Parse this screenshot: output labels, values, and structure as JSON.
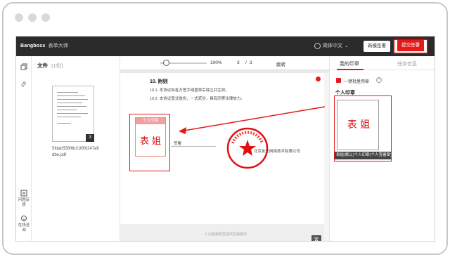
{
  "window": {
    "controls": [
      "dot",
      "dot",
      "dot"
    ]
  },
  "topbar": {
    "logo": "Bangboss",
    "logo_sub": "表单大师",
    "language": "简体中文",
    "switch_button": "新模签署",
    "submit_button": "提交签署"
  },
  "leftrail": {
    "items": [
      {
        "icon": "copy-icon"
      },
      {
        "icon": "paperclip-icon"
      },
      {
        "icon": "feedback-icon",
        "label": "问题反馈"
      },
      {
        "icon": "support-icon",
        "label": "在线咨询"
      }
    ]
  },
  "filepanel": {
    "title": "文件",
    "count": "(1份)",
    "thumbnail_page": "3",
    "filename": "5fdab556f6b31f8f0247a6dbe.pdf"
  },
  "viewer": {
    "zoom": "100%",
    "page_current": "3",
    "page_sep": "/",
    "page_total": "3",
    "goto": "跳转",
    "doc": {
      "heading": "10. 附则",
      "line1": "10.1.   本协议自各方签字或盖章后成立并生效。",
      "line2": "10.2.   本协议壹式叁份，一式贰份，具有同等法律效力。",
      "sign_label": "签署",
      "company": "北京友元网络技术有限公司"
    },
    "stamp_placeholder_label": "个人印章",
    "stamp_placeholder_name": "表 姐",
    "footer": "© 由金融帮签提供签署服务"
  },
  "rightpanel": {
    "tabs": [
      "我的印章",
      "任务信息"
    ],
    "active_tab": 0,
    "option_label": "一键批量用章",
    "section_title": "个人印章",
    "seal_name": "表 姐",
    "seal_caption": "表姐(默认)个人印章(个人签署章)"
  },
  "colors": {
    "accent": "#e21a1a",
    "topbar": "#2b2b2b"
  }
}
